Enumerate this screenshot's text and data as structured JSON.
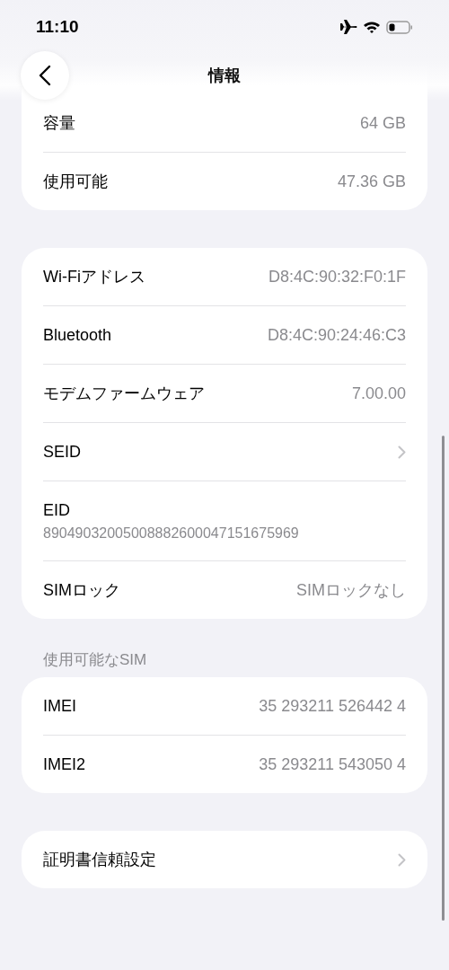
{
  "status_bar": {
    "time": "11:10",
    "airplane_mode": true,
    "wifi": true
  },
  "nav": {
    "title": "情報"
  },
  "groups": [
    {
      "rows": [
        {
          "kind": "value",
          "label": "容量",
          "value": "64 GB"
        },
        {
          "kind": "value",
          "label": "使用可能",
          "value": "47.36 GB"
        }
      ]
    },
    {
      "rows": [
        {
          "kind": "value",
          "label": "Wi-Fiアドレス",
          "value": "D8:4C:90:32:F0:1F"
        },
        {
          "kind": "value",
          "label": "Bluetooth",
          "value": "D8:4C:90:24:46:C3"
        },
        {
          "kind": "value",
          "label": "モデムファームウェア",
          "value": "7.00.00"
        },
        {
          "kind": "link",
          "label": "SEID"
        },
        {
          "kind": "stacked",
          "label": "EID",
          "value": "89049032005008882600047151675969"
        },
        {
          "kind": "value",
          "label": "SIMロック",
          "value": "SIMロックなし"
        }
      ]
    },
    {
      "header": "使用可能なSIM",
      "rows": [
        {
          "kind": "value",
          "label": "IMEI",
          "value": "35 293211 526442 4"
        },
        {
          "kind": "value",
          "label": "IMEI2",
          "value": "35 293211 543050 4"
        }
      ]
    },
    {
      "rows": [
        {
          "kind": "link",
          "label": "証明書信頼設定"
        }
      ]
    }
  ]
}
